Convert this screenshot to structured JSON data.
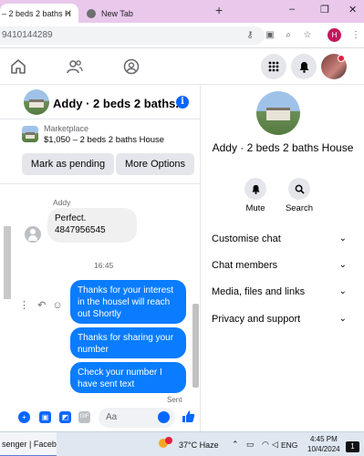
{
  "browser": {
    "tabs": [
      {
        "title": "– 2 beds 2 baths H",
        "active": true
      },
      {
        "title": "New Tab",
        "active": false
      }
    ],
    "new_tab_symbol": "+",
    "window_controls": {
      "minimize": "–",
      "restore": "❐",
      "close": "✕"
    },
    "url": "9410144289",
    "profile_initial": "H"
  },
  "chat": {
    "title": "Addy · 2 beds 2 baths...",
    "listing": {
      "label": "Marketplace",
      "title": "$1,050 – 2 beds 2 baths House"
    },
    "buttons": {
      "mark_pending": "Mark as pending",
      "more_options": "More Options"
    },
    "messages": {
      "sender_name": "Addy",
      "incoming_line1": "Perfect.",
      "incoming_line2": "4847956545",
      "timestamp": "16:45",
      "outgoing": [
        "Thanks for your interest in the housel will reach out Shortly",
        "Thanks  for  sharing your number",
        "Check your number  I have  sent text"
      ],
      "sent_label": "Sent"
    },
    "composer": {
      "placeholder": "Aa"
    }
  },
  "info_panel": {
    "title": "Addy · 2 beds 2 baths House",
    "quick_actions": [
      {
        "label": "Mute",
        "icon": "bell-icon"
      },
      {
        "label": "Search",
        "icon": "search-icon"
      }
    ],
    "menu": [
      "Customise chat",
      "Chat members",
      "Media, files and links",
      "Privacy and support"
    ]
  },
  "taskbar": {
    "app_label": "senger | Facebo...",
    "weather": "37°C  Haze",
    "language": "ENG",
    "time": "4:45 PM",
    "date": "10/4/2024",
    "notification_count": "1"
  },
  "colors": {
    "messenger_blue": "#0a7cff",
    "tab_strip": "#e9c8ec",
    "notification_red": "#e41e3f"
  }
}
